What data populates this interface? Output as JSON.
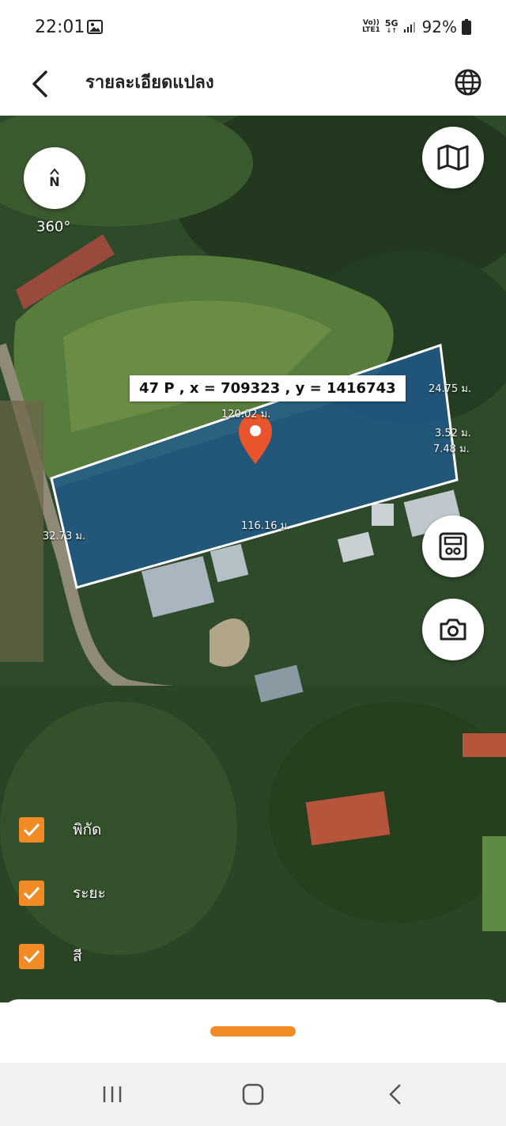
{
  "status": {
    "time": "22:01",
    "net_top": "Vo))",
    "net_bottom": "LTE1",
    "net_5g": "5G",
    "battery": "92%"
  },
  "header": {
    "title": "รายละเอียดแปลง"
  },
  "map": {
    "compass_letter": "N",
    "compass_degrees": "360°",
    "coordinate_label": "47 P , x = 709323 , y = 1416743",
    "distances": {
      "top": "120.02 ม.",
      "top_right": "24.75 ม.",
      "right_a": "3.52 ม.",
      "right_b": "7.48 ม.",
      "bottom": "116.16 ม.",
      "left": "32.73 ม."
    },
    "colors": {
      "parcel_fill": "#1f5a8f",
      "pin": "#e8542c",
      "accent": "#f08a24"
    }
  },
  "toggles": [
    {
      "label": "พิกัด",
      "checked": true
    },
    {
      "label": "ระยะ",
      "checked": true
    },
    {
      "label": "สี",
      "checked": true
    }
  ]
}
